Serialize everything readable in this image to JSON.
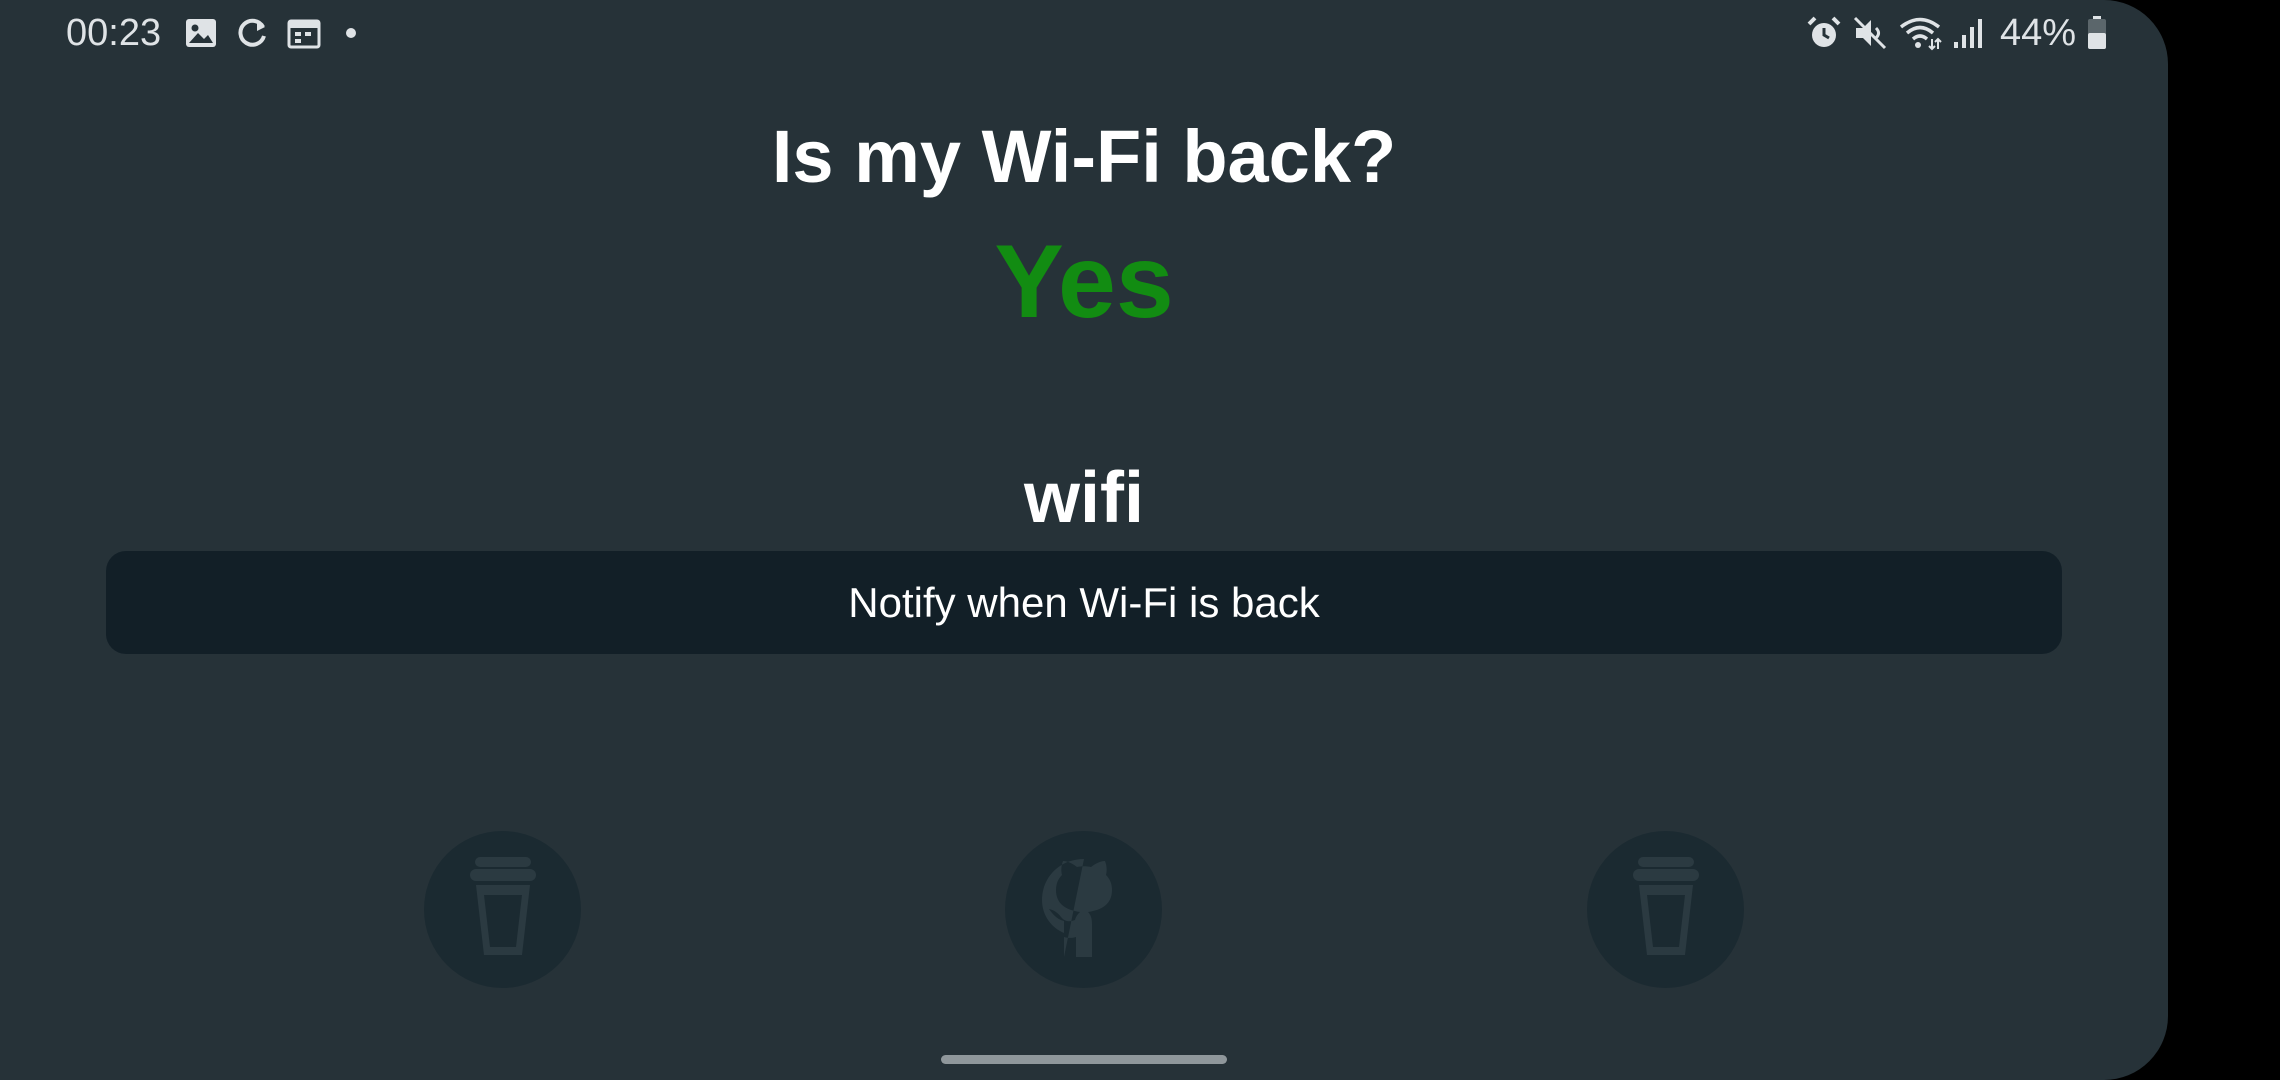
{
  "status_bar": {
    "time": "00:23",
    "left_icons": [
      "image-icon",
      "sync-icon",
      "calendar-icon",
      "dot-icon"
    ],
    "right_icons": [
      "alarm-icon",
      "mute-icon",
      "wifi-icon",
      "signal-icon",
      "battery-icon"
    ],
    "battery_percent": "44%"
  },
  "main": {
    "title": "Is my Wi-Fi back?",
    "answer": "Yes",
    "answer_color": "#128c12",
    "network_name": "wifi",
    "notify_button_label": "Notify when Wi-Fi is back"
  },
  "footer": {
    "buttons": [
      {
        "icon": "coffee-cup-icon"
      },
      {
        "icon": "github-icon"
      },
      {
        "icon": "coffee-cup-icon"
      }
    ]
  },
  "colors": {
    "background": "#263238",
    "button_background": "#121f27",
    "circle_background": "#1b2a31",
    "icon_muted": "#2b3a41"
  }
}
